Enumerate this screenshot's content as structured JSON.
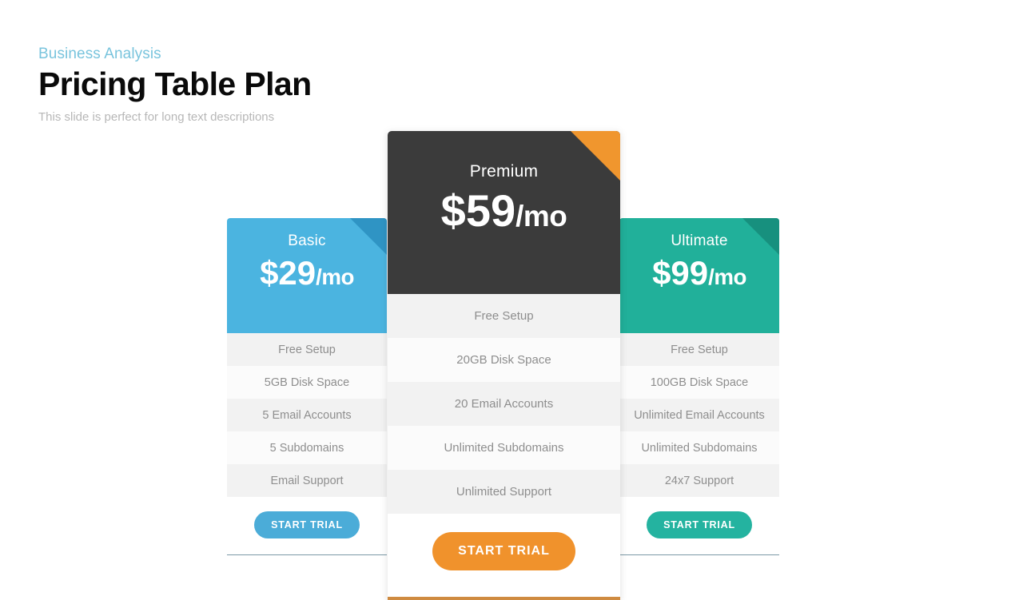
{
  "header": {
    "eyebrow": "Business Analysis",
    "title": "Pricing Table Plan",
    "subtitle": "This slide is perfect for long text descriptions",
    "eyebrow_color": "#79c4dd",
    "title_color": "#0a0a0a",
    "subtitle_color": "#b7b7b7"
  },
  "plans": {
    "basic": {
      "name": "Basic",
      "price": "$29",
      "period": "/mo",
      "accent_color": "#4bb4e0",
      "fold_color": "#2f94c4",
      "button_color": "#4bacd8",
      "bottom_rule_color": "#7b99a6",
      "cta_label": "START TRIAL",
      "features": [
        "Free Setup",
        "5GB Disk Space",
        "5 Email Accounts",
        "5 Subdomains",
        "Email Support"
      ]
    },
    "premium": {
      "name": "Premium",
      "price": "$59",
      "period": "/mo",
      "accent_color": "#3b3b3b",
      "fold_color": "#f0962e",
      "button_color": "#f0922c",
      "bottom_rule_color": "#cf8b41",
      "cta_label": "START TRIAL",
      "features": [
        "Free Setup",
        "20GB Disk Space",
        "20 Email Accounts",
        "Unlimited Subdomains",
        "Unlimited Support"
      ]
    },
    "ultimate": {
      "name": "Ultimate",
      "price": "$99",
      "period": "/mo",
      "accent_color": "#21b09a",
      "fold_color": "#17907e",
      "button_color": "#24b3a0",
      "bottom_rule_color": "#7b99a6",
      "cta_label": "START TRIAL",
      "features": [
        "Free Setup",
        "100GB Disk Space",
        "Unlimited Email Accounts",
        "Unlimited Subdomains",
        "24x7 Support"
      ]
    }
  }
}
